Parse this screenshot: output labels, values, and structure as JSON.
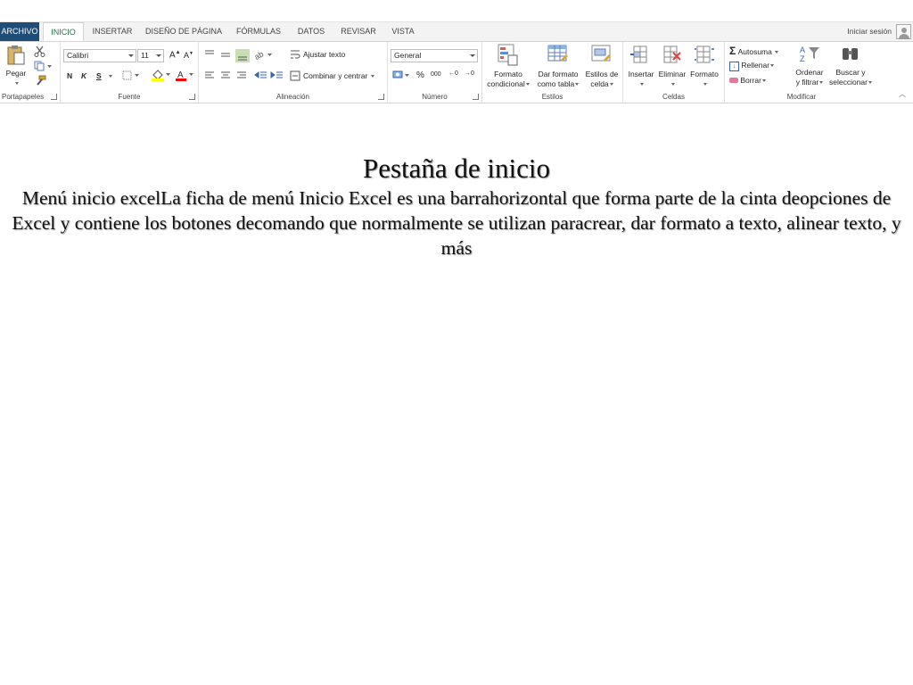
{
  "ribbon": {
    "tabs": [
      {
        "label": "ARCHIVO"
      },
      {
        "label": "INICIO"
      },
      {
        "label": "INSERTAR"
      },
      {
        "label": "DISEÑO DE PÁGINA"
      },
      {
        "label": "FÓRMULAS"
      },
      {
        "label": "DATOS"
      },
      {
        "label": "REVISAR"
      },
      {
        "label": "VISTA"
      }
    ],
    "active_tab": "INICIO",
    "sign_in": "Iniciar sesión",
    "clipboard": {
      "label": "Portapapeles",
      "paste": "Pegar"
    },
    "font": {
      "label": "Fuente",
      "font_name": "Calibri",
      "font_size": "11",
      "bold": "N",
      "italic": "K",
      "underline": "S"
    },
    "alignment": {
      "label": "Alineación",
      "wrap": "Ajustar texto",
      "merge": "Combinar y centrar"
    },
    "number": {
      "label": "Número",
      "format": "General",
      "percent": "%",
      "thousands": "000"
    },
    "styles": {
      "label": "Estilos",
      "cond_1": "Formato",
      "cond_2": "condicional",
      "table_1": "Dar formato",
      "table_2": "como tabla",
      "cell_1": "Estilos de",
      "cell_2": "celda"
    },
    "cells": {
      "label": "Celdas",
      "insert": "Insertar",
      "delete": "Eliminar",
      "format": "Formato"
    },
    "editing": {
      "label": "Modificar",
      "autosum": "Autosuma",
      "fill": "Rellenar",
      "clear": "Borrar",
      "sort_1": "Ordenar",
      "sort_2": "y filtrar",
      "find_1": "Buscar y",
      "find_2": "seleccionar"
    },
    "colors": {
      "accent": "#217346",
      "file_tab": "#1e4e78",
      "highlight": "#ffff00",
      "font_color": "#ff0000"
    }
  },
  "slide": {
    "title": "Pestaña de inicio",
    "body": "Menú inicio excelLa ficha de menú Inicio Excel es una barrahorizontal que forma parte de la cinta deopciones de Excel y contiene los botones decomando que normalmente se utilizan paracrear, dar formato a texto, alinear texto, y más"
  }
}
